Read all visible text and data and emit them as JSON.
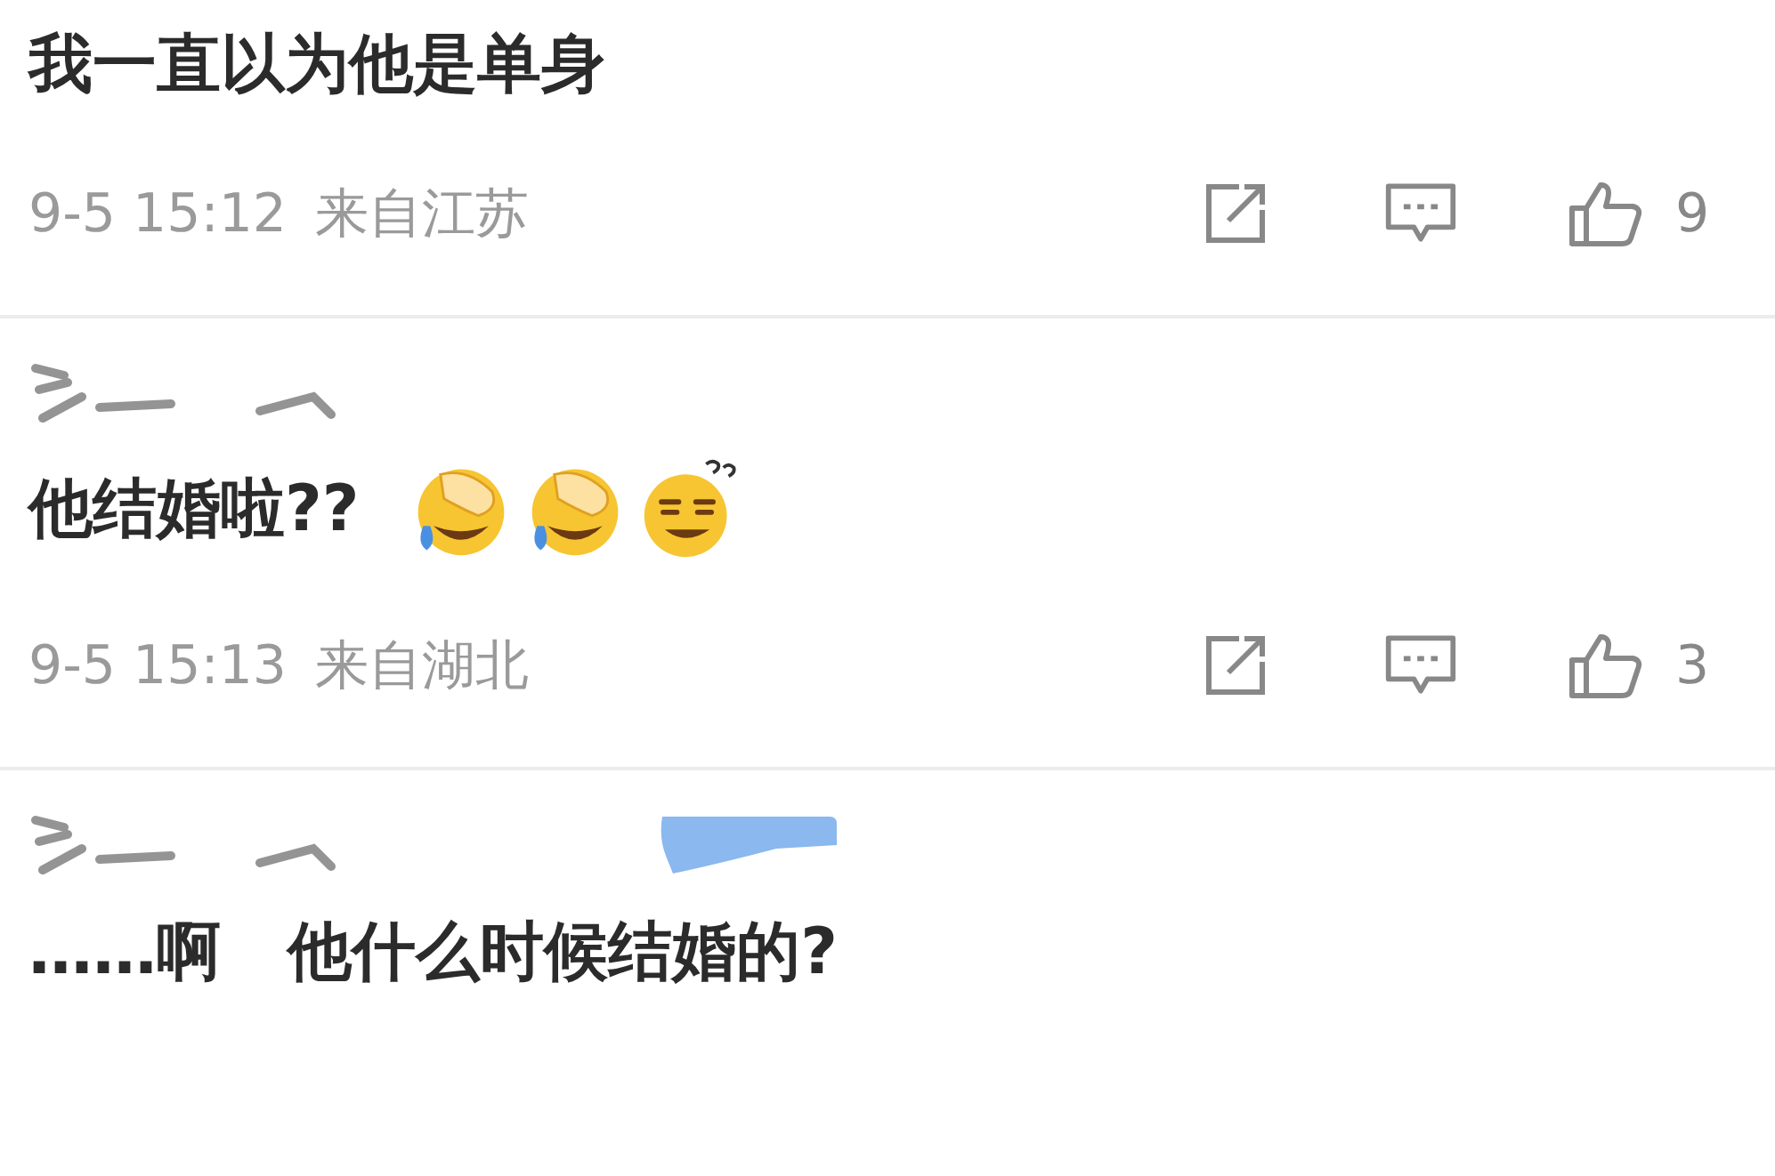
{
  "comments": [
    {
      "text": "我一直以为他是单身",
      "meta": {
        "time": "9-5 15:12",
        "location": "来自江苏",
        "likes": "9"
      }
    },
    {
      "name_erased": true,
      "text": "他结婚啦??",
      "emojis": [
        {
          "kind": "facepalm"
        },
        {
          "kind": "facepalm"
        },
        {
          "kind": "puzzled"
        }
      ],
      "meta": {
        "time": "9-5 15:13",
        "location": "来自湖北",
        "likes": "3"
      }
    },
    {
      "name_erased": true,
      "badge_erased": true,
      "text": "……啊   他什么时候结婚的?"
    }
  ]
}
